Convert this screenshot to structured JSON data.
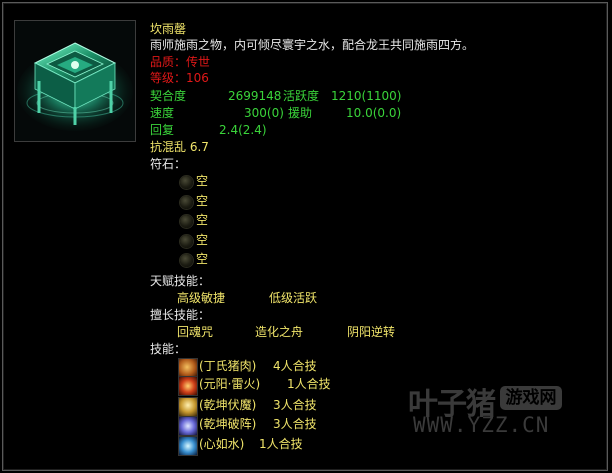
{
  "item": {
    "name": "坎雨罄",
    "description": "雨师施雨之物，内可倾尽寰宇之水，配合龙王共同施雨四方。",
    "quality_label": "品质：",
    "quality_value": "传世",
    "level_label": "等级：",
    "level_value": "106",
    "stats": {
      "affinity_label": "契合度",
      "affinity_value": "2699148",
      "activity_label": "活跃度",
      "activity_value": "1210(1100)",
      "speed_label": "速度",
      "speed_value": "300(0)",
      "assist_label": "援助",
      "assist_value": "10.0(0.0)",
      "recover_label": "回复",
      "recover_value": "2.4(2.4)"
    },
    "resist": "抗混乱 6.7"
  },
  "runes": {
    "label": "符石：",
    "slots": [
      "空",
      "空",
      "空",
      "空",
      "空"
    ]
  },
  "talents": {
    "label": "天赋技能：",
    "items": [
      "高级敏捷",
      "低级活跃"
    ]
  },
  "specialties": {
    "label": "擅长技能：",
    "items": [
      "回魂咒",
      "造化之舟",
      "阴阳逆转"
    ]
  },
  "skills": {
    "label": "技能：",
    "items": [
      {
        "name": "(丁氏猪肉)",
        "tag": "4人合技"
      },
      {
        "name": "(元阳·雷火)",
        "tag": "1人合技"
      },
      {
        "name": "(乾坤伏魔)",
        "tag": "3人合技"
      },
      {
        "name": "(乾坤破阵)",
        "tag": "3人合技"
      },
      {
        "name": "(心如水)",
        "tag": "1人合技"
      }
    ]
  },
  "watermark": {
    "brand": "叶子猪",
    "badge": "游戏网",
    "url": "WWW.YZZ.CN"
  },
  "colors": {
    "title_yellow": "#f0e46a",
    "quality_red": "#e01818",
    "stat_green": "#3ad43a",
    "text_white": "#e8e8e8"
  }
}
